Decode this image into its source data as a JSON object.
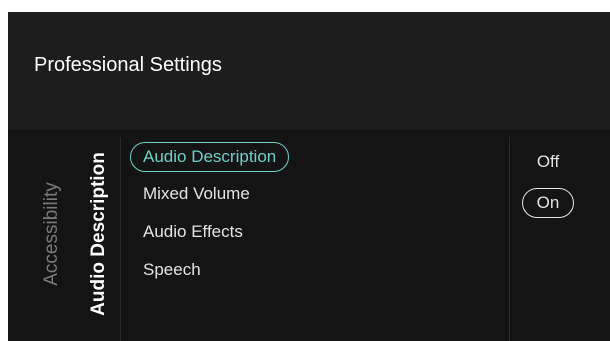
{
  "header": {
    "title": "Professional Settings"
  },
  "breadcrumb": {
    "parent": "Accessibility",
    "current": "Audio Description"
  },
  "menu": {
    "items": [
      {
        "label": "Audio Description",
        "selected": true
      },
      {
        "label": "Mixed Volume",
        "selected": false
      },
      {
        "label": "Audio Effects",
        "selected": false
      },
      {
        "label": "Speech",
        "selected": false
      }
    ]
  },
  "options": {
    "items": [
      {
        "label": "Off",
        "selected": false
      },
      {
        "label": "On",
        "selected": true
      }
    ]
  },
  "colors": {
    "accent": "#6fd0c6",
    "background": "#141414",
    "header_background": "#1d1d1d"
  }
}
